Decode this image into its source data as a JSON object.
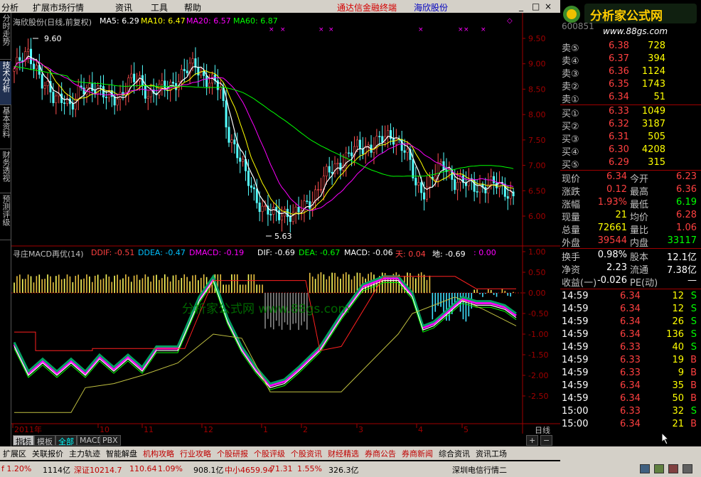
{
  "menu": {
    "items": [
      "分析",
      "扩展市场行情",
      "资讯",
      "工具",
      "帮助"
    ],
    "title_left": "通达信金融终端",
    "title_right": "海欣股份",
    "window_buttons": [
      "_",
      "□",
      "×"
    ]
  },
  "ad": {
    "brand": "分析家公式网",
    "url": "www.88gs.com",
    "code": "600851"
  },
  "left_tabs": [
    "分时走势",
    "技术分析",
    "基本资料",
    "财务透视",
    "预测评级"
  ],
  "main_chart": {
    "legend_name": "海欣股份(日线,前复权)",
    "legend_ma": [
      {
        "label": "MA5: 6.29",
        "color": "#ffffff"
      },
      {
        "label": "MA10: 6.47",
        "color": "#ffff00"
      },
      {
        "label": "MA20: 6.57",
        "color": "#ff00ff"
      },
      {
        "label": "MA60: 6.87",
        "color": "#00ff00"
      }
    ],
    "high_label": "9.60",
    "low_label": "5.63",
    "y_ticks": [
      "9.50",
      "9.00",
      "8.50",
      "8.00",
      "7.50",
      "7.00",
      "6.50",
      "6.00"
    ],
    "watermark": "分析家公式网 www.88gs.com"
  },
  "indicator": {
    "name": "寻庄MACD再优(14)",
    "values": [
      {
        "label": "DDIF: -0.51",
        "color": "#ff4040"
      },
      {
        "label": "DDEA: -0.47",
        "color": "#00c0ff"
      },
      {
        "label": "DMACD: -0.19",
        "color": "#ff00ff"
      },
      {
        "label": "DIF: -0.69",
        "color": "#ffffff"
      },
      {
        "label": "DEA: -0.67",
        "color": "#00ff00"
      },
      {
        "label": "MACD: -0.06",
        "color": "#ffffff"
      },
      {
        "label": "天: 0.04",
        "color": "#ff4040"
      },
      {
        "label": "地: -0.69",
        "color": "#ffffff"
      },
      {
        "label": ": 0.00",
        "color": "#ff00ff"
      }
    ],
    "y_ticks": [
      "1.00",
      "0.50",
      "0.00",
      "-0.50",
      "-1.00",
      "-1.50",
      "-2.00",
      "-2.50"
    ]
  },
  "x_axis": [
    "2011年",
    "10",
    "11",
    "12",
    "1",
    "2",
    "3",
    "4",
    "5"
  ],
  "period": "日线",
  "bottom_tabs": [
    "指标",
    "模板",
    "全部",
    "MACD",
    "PBX"
  ],
  "quote": {
    "code_hint": "600851",
    "asks": [
      {
        "label": "卖⑤",
        "price": "6.38",
        "vol": "728"
      },
      {
        "label": "卖④",
        "price": "6.37",
        "vol": "394"
      },
      {
        "label": "卖③",
        "price": "6.36",
        "vol": "1124"
      },
      {
        "label": "卖②",
        "price": "6.35",
        "vol": "1743"
      },
      {
        "label": "卖①",
        "price": "6.34",
        "vol": "51"
      }
    ],
    "bids": [
      {
        "label": "买①",
        "price": "6.33",
        "vol": "1049"
      },
      {
        "label": "买②",
        "price": "6.32",
        "vol": "3187"
      },
      {
        "label": "买③",
        "price": "6.31",
        "vol": "505"
      },
      {
        "label": "买④",
        "price": "6.30",
        "vol": "4208"
      },
      {
        "label": "买⑤",
        "price": "6.29",
        "vol": "315"
      }
    ],
    "stats": [
      {
        "l1": "现价",
        "v1": "6.34",
        "c1": "#ff4040",
        "l2": "今开",
        "v2": "6.23",
        "c2": "#ff4040"
      },
      {
        "l1": "涨跌",
        "v1": "0.12",
        "c1": "#ff4040",
        "l2": "最高",
        "v2": "6.36",
        "c2": "#ff4040"
      },
      {
        "l1": "涨幅",
        "v1": "1.93%",
        "c1": "#ff4040",
        "l2": "最低",
        "v2": "6.19",
        "c2": "#00ff00"
      },
      {
        "l1": "现量",
        "v1": "21",
        "c1": "#ffff00",
        "l2": "均价",
        "v2": "6.28",
        "c2": "#ff4040"
      },
      {
        "l1": "总量",
        "v1": "72661",
        "c1": "#ffff00",
        "l2": "量比",
        "v2": "1.06",
        "c2": "#ff4040"
      },
      {
        "l1": "外盘",
        "v1": "39544",
        "c1": "#ff4040",
        "l2": "内盘",
        "v2": "33117",
        "c2": "#00ff00"
      }
    ],
    "fin": [
      {
        "l1": "换手",
        "v1": "0.98%",
        "l2": "股本",
        "v2": "12.1亿"
      },
      {
        "l1": "净资",
        "v1": "2.23",
        "l2": "流通",
        "v2": "7.38亿"
      },
      {
        "l1": "收益(一)",
        "v1": "-0.026",
        "l2": "PE(动)",
        "v2": "—"
      }
    ],
    "ticks": [
      {
        "t": "14:59",
        "p": "6.34",
        "v": "12",
        "s": "S"
      },
      {
        "t": "14:59",
        "p": "6.34",
        "v": "12",
        "s": "S"
      },
      {
        "t": "14:59",
        "p": "6.34",
        "v": "26",
        "s": "S"
      },
      {
        "t": "14:59",
        "p": "6.34",
        "v": "136",
        "s": "S"
      },
      {
        "t": "14:59",
        "p": "6.33",
        "v": "40",
        "s": "S"
      },
      {
        "t": "14:59",
        "p": "6.33",
        "v": "19",
        "s": "B"
      },
      {
        "t": "14:59",
        "p": "6.33",
        "v": "9",
        "s": "B"
      },
      {
        "t": "14:59",
        "p": "6.34",
        "v": "35",
        "s": "B"
      },
      {
        "t": "14:59",
        "p": "6.34",
        "v": "50",
        "s": "B"
      },
      {
        "t": "15:00",
        "p": "6.33",
        "v": "32",
        "s": "S"
      },
      {
        "t": "15:00",
        "p": "6.34",
        "v": "21",
        "s": "B"
      }
    ]
  },
  "right_tabs": [
    "笔",
    "价",
    "细",
    "盘",
    "势",
    "指",
    "联",
    "筹"
  ],
  "nav": [
    "扩展区",
    "关联报价",
    "主力轨迹",
    "智能解盘",
    "机构攻略",
    "行业攻略",
    "个股研报",
    "个股评级",
    "个股资讯",
    "财经精选",
    "券商公告",
    "券商新闻",
    "综合资讯",
    "资讯工场"
  ],
  "status": [
    {
      "t": "f 1.20%",
      "c": "#c00000"
    },
    {
      "t": "1114亿",
      "c": "#000000"
    },
    {
      "t": "深证10214.7",
      "c": "#c00000"
    },
    {
      "t": "110.64",
      "c": "#c00000"
    },
    {
      "t": "1.09%",
      "c": "#c00000"
    },
    {
      "t": "908.1亿",
      "c": "#000000"
    },
    {
      "t": "中小4659.94",
      "c": "#c00000"
    },
    {
      "t": "71.31",
      "c": "#c00000"
    },
    {
      "t": "1.55%",
      "c": "#c00000"
    },
    {
      "t": "326.3亿",
      "c": "#000000"
    },
    {
      "t": "深圳电信行情二",
      "c": "#000000"
    }
  ]
}
